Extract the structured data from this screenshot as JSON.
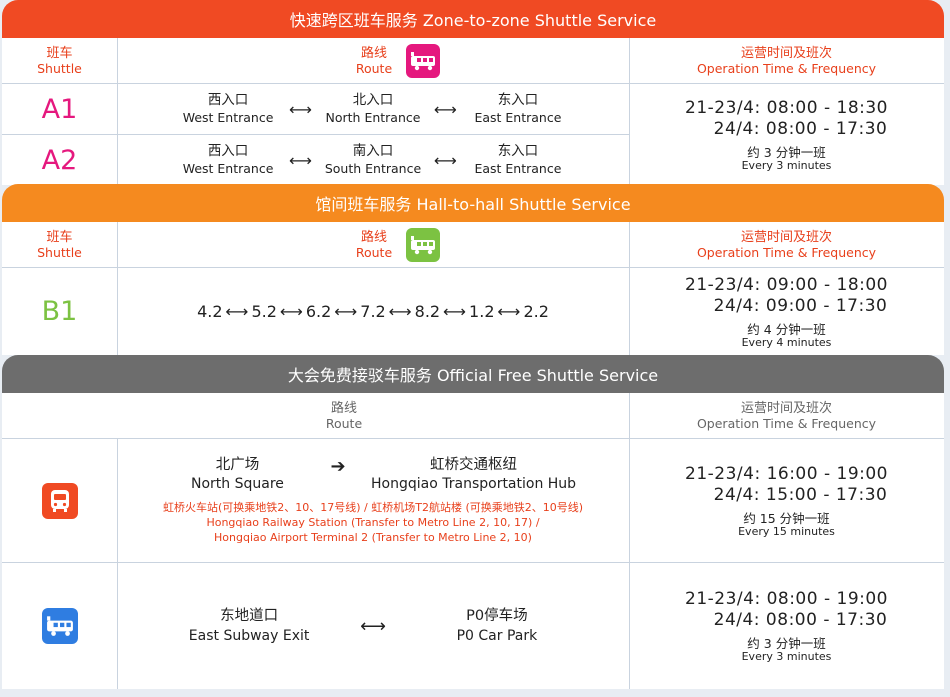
{
  "zone": {
    "title": "快速跨区班车服务 Zone-to-zone Shuttle Service",
    "hdr_shuttle_zh": "班车",
    "hdr_shuttle_en": "Shuttle",
    "hdr_route_zh": "路线",
    "hdr_route_en": "Route",
    "hdr_time_zh": "运营时间及班次",
    "hdr_time_en": "Operation Time & Frequency",
    "rows": [
      {
        "code": "A1",
        "stops": [
          {
            "zh": "西入口",
            "en": "West Entrance"
          },
          {
            "zh": "北入口",
            "en": "North Entrance"
          },
          {
            "zh": "东入口",
            "en": "East Entrance"
          }
        ],
        "time1": "21-23/4:  08:00 - 18:30",
        "time2": "24/4:  08:00 - 17:30",
        "freq_zh": "约 3 分钟一班",
        "freq_en": "Every 3 minutes"
      },
      {
        "code": "A2",
        "stops": [
          {
            "zh": "西入口",
            "en": "West Entrance"
          },
          {
            "zh": "南入口",
            "en": "South Entrance"
          },
          {
            "zh": "东入口",
            "en": "East Entrance"
          }
        ]
      }
    ]
  },
  "hall": {
    "title": "馆间班车服务 Hall-to-hall Shuttle Service",
    "hdr_shuttle_zh": "班车",
    "hdr_shuttle_en": "Shuttle",
    "hdr_route_zh": "路线",
    "hdr_route_en": "Route",
    "hdr_time_zh": "运营时间及班次",
    "hdr_time_en": "Operation Time & Frequency",
    "code": "B1",
    "halls": [
      "4.2",
      "5.2",
      "6.2",
      "7.2",
      "8.2",
      "1.2",
      "2.2"
    ],
    "time1": "21-23/4:  09:00 - 18:00",
    "time2": "24/4:  09:00 - 17:30",
    "freq_zh": "约 4 分钟一班",
    "freq_en": "Every 4 minutes"
  },
  "official": {
    "title": "大会免费接驳车服务 Official Free Shuttle Service",
    "hdr_route_zh": "路线",
    "hdr_route_en": "Route",
    "hdr_time_zh": "运营时间及班次",
    "hdr_time_en": "Operation Time & Frequency",
    "bus": {
      "from_zh": "北广场",
      "from_en": "North Square",
      "to_zh": "虹桥交通枢纽",
      "to_en": "Hongqiao Transportation Hub",
      "note_zh": "虹桥火车站(可换乘地铁2、10、17号线) / 虹桥机场T2航站楼 (可换乘地铁2、10号线)",
      "note_en1": "Hongqiao Railway Station (Transfer to Metro Line 2, 10, 17) /",
      "note_en2": "Hongqiao Airport Terminal 2 (Transfer to Metro Line 2, 10)",
      "time1": "21-23/4:  16:00 - 19:00",
      "time2": "24/4:  15:00 - 17:30",
      "freq_zh": "约 15 分钟一班",
      "freq_en": "Every 15 minutes"
    },
    "shuttle": {
      "from_zh": "东地道口",
      "from_en": "East Subway Exit",
      "to_zh": "P0停车场",
      "to_en": "P0 Car Park",
      "time1": "21-23/4:  08:00 - 19:00",
      "time2": "24/4:  08:00 - 17:30",
      "freq_zh": "约 3 分钟一班",
      "freq_en": "Every 3 minutes"
    }
  },
  "colors": {
    "zone": "#f04a23",
    "hall": "#f58a1f",
    "official": "#6d6d6d",
    "zone_icon": "#e5187e",
    "hall_icon": "#7cc242",
    "bus_icon": "#f04a23",
    "shuttle_icon": "#2f7de1"
  },
  "icons": {
    "zone_route": "shuttle-icon",
    "hall_route": "shuttle-icon",
    "bus": "bus-icon",
    "shuttle": "shuttle-icon"
  }
}
